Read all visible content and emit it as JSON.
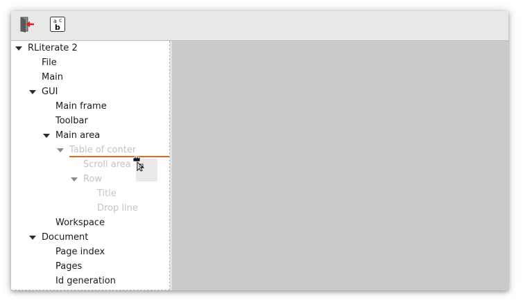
{
  "toolbar": {
    "buttons": [
      {
        "name": "quit-icon"
      },
      {
        "name": "spelling-icon",
        "glyph_top_a": "a",
        "glyph_top_c": "c",
        "glyph_bottom": "b"
      }
    ]
  },
  "tree": {
    "items": [
      {
        "label": "RLiterate 2",
        "expanded": true
      },
      {
        "label": "File"
      },
      {
        "label": "Main"
      },
      {
        "label": "GUI",
        "expanded": true
      },
      {
        "label": "Main frame"
      },
      {
        "label": "Toolbar"
      },
      {
        "label": "Main area",
        "expanded": true
      },
      {
        "label": "Table of contents",
        "expanded": true,
        "dragging": true
      },
      {
        "label": "Scroll area",
        "dragging": true
      },
      {
        "label": "Row",
        "expanded": true,
        "dragging": true
      },
      {
        "label": "Title",
        "dragging": true
      },
      {
        "label": "Drop line",
        "dragging": true
      },
      {
        "label": "Workspace"
      },
      {
        "label": "Document",
        "expanded": true
      },
      {
        "label": "Page index"
      },
      {
        "label": "Pages"
      },
      {
        "label": "Id generation"
      }
    ]
  },
  "colors": {
    "toolbar_bg": "#e8e8e7",
    "workspace_bg": "#cacaca",
    "drop_line": "#e06a17",
    "quit_arrow": "#e02020"
  }
}
